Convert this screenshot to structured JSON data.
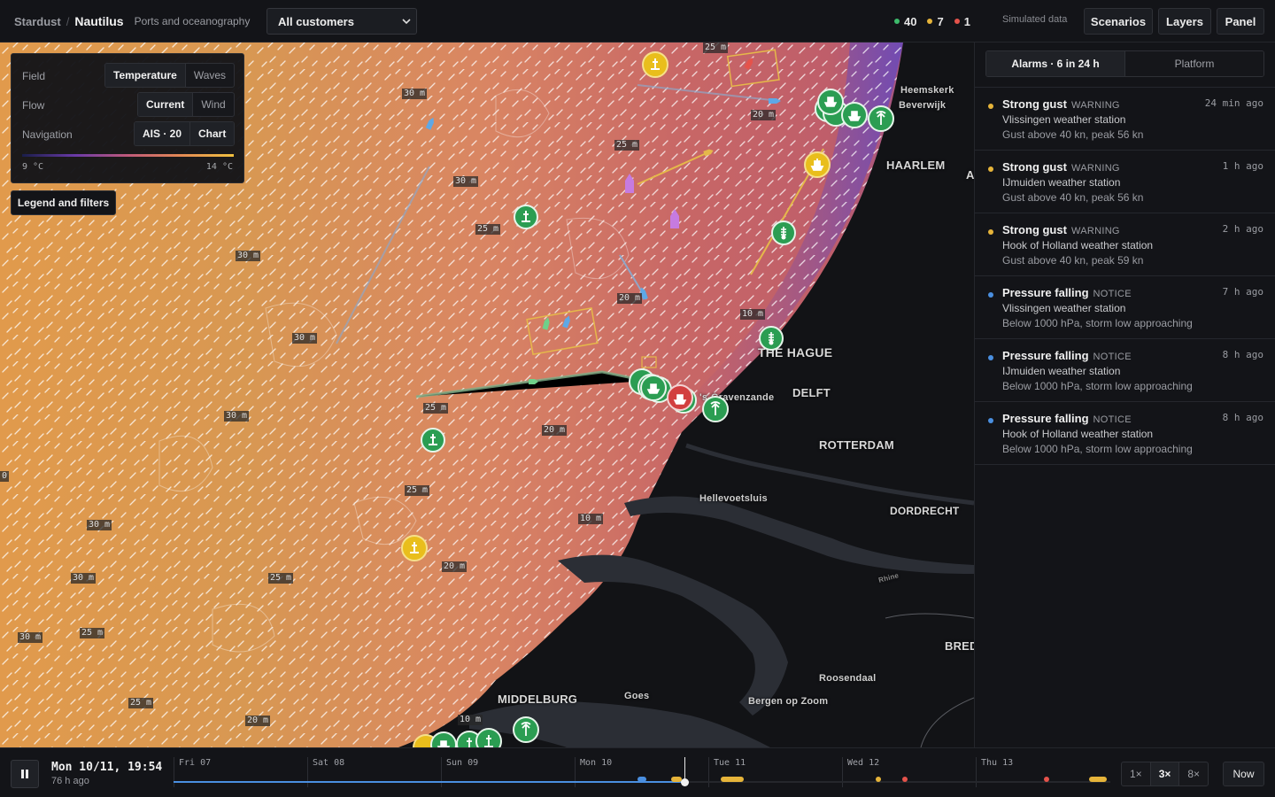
{
  "header": {
    "brand": "Stardust",
    "separator": "/",
    "product": "Nautilus",
    "subtitle": "Ports and oceanography",
    "customer_select": {
      "value": "All customers"
    },
    "status_counts": [
      {
        "color": "#3dbb6b",
        "count": "40"
      },
      {
        "color": "#e6b43a",
        "count": "7"
      },
      {
        "color": "#e5534b",
        "count": "1"
      }
    ],
    "simulated_label": "Simulated data",
    "buttons": {
      "scenarios": "Scenarios",
      "layers": "Layers",
      "panel": "Panel"
    }
  },
  "legend": {
    "field_label": "Field",
    "field_options": [
      "Temperature",
      "Waves"
    ],
    "flow_label": "Flow",
    "flow_options": [
      "Current",
      "Wind"
    ],
    "navigation_label": "Navigation",
    "navigation_options": [
      "AIS · 20",
      "Chart"
    ],
    "scale_min": "9 °C",
    "scale_max": "14 °C",
    "filters_button": "Legend and filters"
  },
  "map": {
    "places": {
      "heemskerk": "Heemskerk",
      "beverwijk": "Beverwijk",
      "haarlem": "HAARLEM",
      "the_hague": "THE HAGUE",
      "delft": "DELFT",
      "gravenzande": "'s-Gravenzande",
      "rotterdam": "ROTTERDAM",
      "hellevoetsluis": "Hellevoetsluis",
      "dordrecht": "DORDRECHT",
      "breda": "BRED",
      "roosendaal": "Roosendaal",
      "bergen_op_zoom": "Bergen op Zoom",
      "goes": "Goes",
      "middelburg": "MIDDELBURG",
      "a_edge": "A",
      "rhine": "Rhine"
    },
    "depths": [
      "25 m",
      "30 m",
      "20 m",
      "25 m",
      "30 m",
      "25 m",
      "30 m",
      "20 m",
      "10 m",
      "30 m",
      "30 m",
      "25 m",
      "20 m",
      "25 m",
      "10 m",
      "30 m",
      "20 m",
      "30 m",
      "25 m",
      "30 m",
      "25 m",
      "25 m",
      "20 m",
      "10 m",
      "0"
    ]
  },
  "side_panel": {
    "tabs": [
      "Alarms · 6 in 24 h",
      "Platform"
    ],
    "alarms": [
      {
        "title": "Strong gust",
        "level": "WARNING",
        "station": "Vlissingen weather station",
        "detail": "Gust above 40 kn, peak 56 kn",
        "ago": "24 min ago",
        "color": "#e6b43a"
      },
      {
        "title": "Strong gust",
        "level": "WARNING",
        "station": "IJmuiden weather station",
        "detail": "Gust above 40 kn, peak 56 kn",
        "ago": "1 h ago",
        "color": "#e6b43a"
      },
      {
        "title": "Strong gust",
        "level": "WARNING",
        "station": "Hook of Holland weather station",
        "detail": "Gust above 40 kn, peak 59 kn",
        "ago": "2 h ago",
        "color": "#e6b43a"
      },
      {
        "title": "Pressure falling",
        "level": "NOTICE",
        "station": "Vlissingen weather station",
        "detail": "Below 1000 hPa, storm low approaching",
        "ago": "7 h ago",
        "color": "#4a8fe0"
      },
      {
        "title": "Pressure falling",
        "level": "NOTICE",
        "station": "IJmuiden weather station",
        "detail": "Below 1000 hPa, storm low approaching",
        "ago": "8 h ago",
        "color": "#4a8fe0"
      },
      {
        "title": "Pressure falling",
        "level": "NOTICE",
        "station": "Hook of Holland weather station",
        "detail": "Below 1000 hPa, storm low approaching",
        "ago": "8 h ago",
        "color": "#4a8fe0"
      }
    ]
  },
  "timeline": {
    "current_time": "Mon 10/11, 19:54",
    "relative": "76 h ago",
    "days": [
      "Fri 07",
      "Sat 08",
      "Sun 09",
      "Mon 10",
      "Tue 11",
      "Wed 12",
      "Thu 13"
    ],
    "speeds": [
      "1×",
      "3×",
      "8×"
    ],
    "active_speed": "3×",
    "now_button": "Now"
  }
}
